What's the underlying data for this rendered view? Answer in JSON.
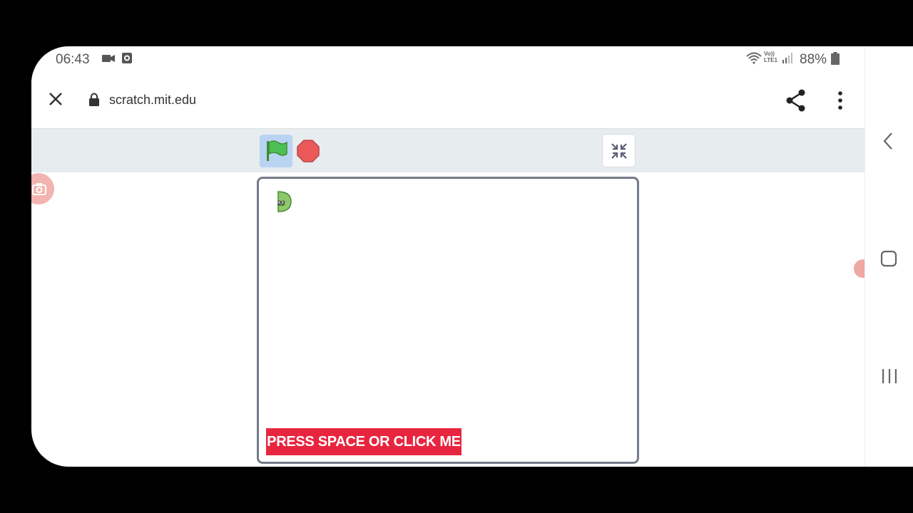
{
  "status_bar": {
    "time": "06:43",
    "network_label": "Vo))\nLTE1",
    "battery": "88%"
  },
  "browser": {
    "url": "scratch.mit.edu",
    "close_icon": "close-icon",
    "lock_icon": "lock-icon",
    "share_icon": "share-icon",
    "menu_icon": "more-vert-icon"
  },
  "scratch_player": {
    "green_flag_icon": "green-flag-icon",
    "stop_icon": "stop-sign-icon",
    "unfullscreen_icon": "unfullscreen-icon",
    "banner_text": "PRESS SPACE OR CLICK ME",
    "banner_color": "#e8253f"
  },
  "nav": {
    "back_icon": "nav-back-icon",
    "home_icon": "nav-home-icon",
    "recents_icon": "nav-recents-icon"
  },
  "colors": {
    "toolbar_bg": "#e7ecef",
    "flag_active_bg": "#b8d4f2",
    "stage_border": "#747b88"
  }
}
